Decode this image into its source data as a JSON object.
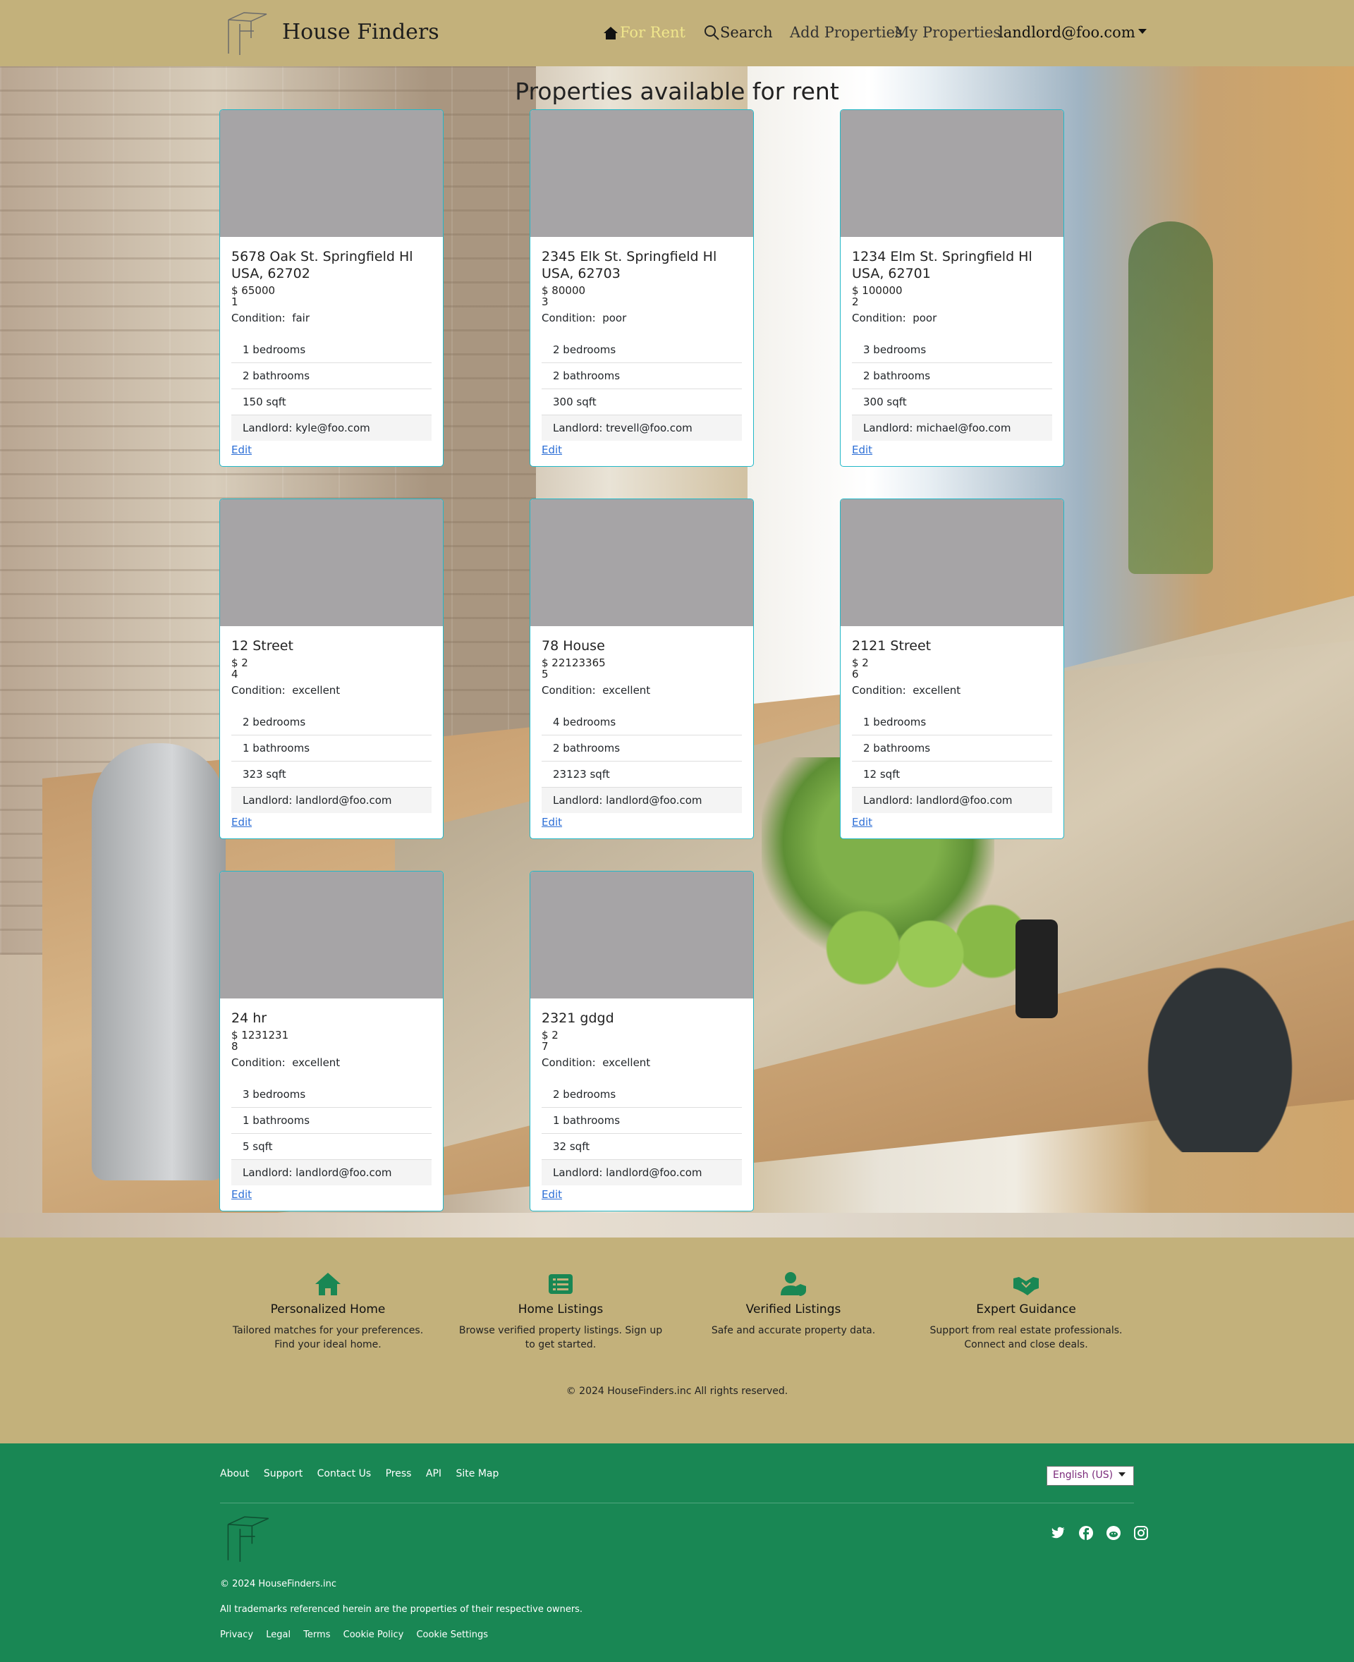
{
  "header": {
    "brand": "House Finders",
    "nav": {
      "for_rent": "For Rent",
      "search": "Search",
      "add_properties": "Add Properties",
      "my_properties": "My Properties",
      "user": "landlord@foo.com"
    }
  },
  "main": {
    "title": "Properties available for rent",
    "properties": [
      {
        "address": "5678 Oak St. Springfield Hl USA, 62702",
        "price": "$ 65000",
        "id": "1",
        "condition_label": "Condition:",
        "condition": "fair",
        "bedrooms": "1  bedrooms",
        "bathrooms": "2  bathrooms",
        "sqft": "150  sqft",
        "landlord": "Landlord:  kyle@foo.com",
        "edit": "Edit"
      },
      {
        "address": "2345 Elk St. Springfield Hl USA, 62703",
        "price": "$ 80000",
        "id": "3",
        "condition_label": "Condition:",
        "condition": "poor",
        "bedrooms": "2  bedrooms",
        "bathrooms": "2  bathrooms",
        "sqft": "300  sqft",
        "landlord": "Landlord:  trevell@foo.com",
        "edit": "Edit"
      },
      {
        "address": "1234 Elm St. Springfield Hl USA, 62701",
        "price": "$ 100000",
        "id": "2",
        "condition_label": "Condition:",
        "condition": "poor",
        "bedrooms": "3  bedrooms",
        "bathrooms": "2  bathrooms",
        "sqft": "300  sqft",
        "landlord": "Landlord:  michael@foo.com",
        "edit": "Edit"
      },
      {
        "address": "12 Street",
        "price": "$ 2",
        "id": "4",
        "condition_label": "Condition:",
        "condition": "excellent",
        "bedrooms": "2  bedrooms",
        "bathrooms": "1  bathrooms",
        "sqft": "323  sqft",
        "landlord": "Landlord:  landlord@foo.com",
        "edit": "Edit"
      },
      {
        "address": "78 House",
        "price": "$ 22123365",
        "id": "5",
        "condition_label": "Condition:",
        "condition": "excellent",
        "bedrooms": "4  bedrooms",
        "bathrooms": "2  bathrooms",
        "sqft": "23123  sqft",
        "landlord": "Landlord:  landlord@foo.com",
        "edit": "Edit"
      },
      {
        "address": "2121 Street",
        "price": "$ 2",
        "id": "6",
        "condition_label": "Condition:",
        "condition": "excellent",
        "bedrooms": "1  bedrooms",
        "bathrooms": "2  bathrooms",
        "sqft": "12  sqft",
        "landlord": "Landlord:  landlord@foo.com",
        "edit": "Edit"
      },
      {
        "address": "24 hr",
        "price": "$ 1231231",
        "id": "8",
        "condition_label": "Condition:",
        "condition": "excellent",
        "bedrooms": "3  bedrooms",
        "bathrooms": "1  bathrooms",
        "sqft": "5  sqft",
        "landlord": "Landlord:  landlord@foo.com",
        "edit": "Edit"
      },
      {
        "address": "2321 gdgd",
        "price": "$ 2",
        "id": "7",
        "condition_label": "Condition:",
        "condition": "excellent",
        "bedrooms": "2  bedrooms",
        "bathrooms": "1  bathrooms",
        "sqft": "32  sqft",
        "landlord": "Landlord:  landlord@foo.com",
        "edit": "Edit"
      }
    ]
  },
  "features": {
    "items": [
      {
        "icon": "house-icon",
        "title": "Personalized Home",
        "desc": "Tailored matches for your preferences. Find your ideal home."
      },
      {
        "icon": "list-icon",
        "title": "Home Listings",
        "desc": "Browse verified property listings. Sign up to get started."
      },
      {
        "icon": "verified-user-icon",
        "title": "Verified Listings",
        "desc": "Safe and accurate property data."
      },
      {
        "icon": "handshake-icon",
        "title": "Expert Guidance",
        "desc": "Support from real estate professionals. Connect and close deals."
      }
    ],
    "copyright": "© 2024 HouseFinders.inc All rights reserved.",
    "icon_color": "#198754"
  },
  "footer": {
    "links": [
      "About",
      "Support",
      "Contact Us",
      "Press",
      "API",
      "Site Map"
    ],
    "language": "English (US)",
    "copyright": "© 2024 HouseFinders.inc",
    "trademark": "All trademarks referenced herein are the properties of their respective owners.",
    "legal_links": [
      "Privacy",
      "Legal",
      "Terms",
      "Cookie Policy",
      "Cookie Settings"
    ],
    "social": [
      "twitter-icon",
      "facebook-icon",
      "reddit-icon",
      "instagram-icon"
    ],
    "background": "#198754"
  },
  "colors": {
    "header_bg": "#c3b17b",
    "active_nav": "#f0e68c",
    "card_border": "#22b8c8",
    "link": "#2d6fd6"
  }
}
